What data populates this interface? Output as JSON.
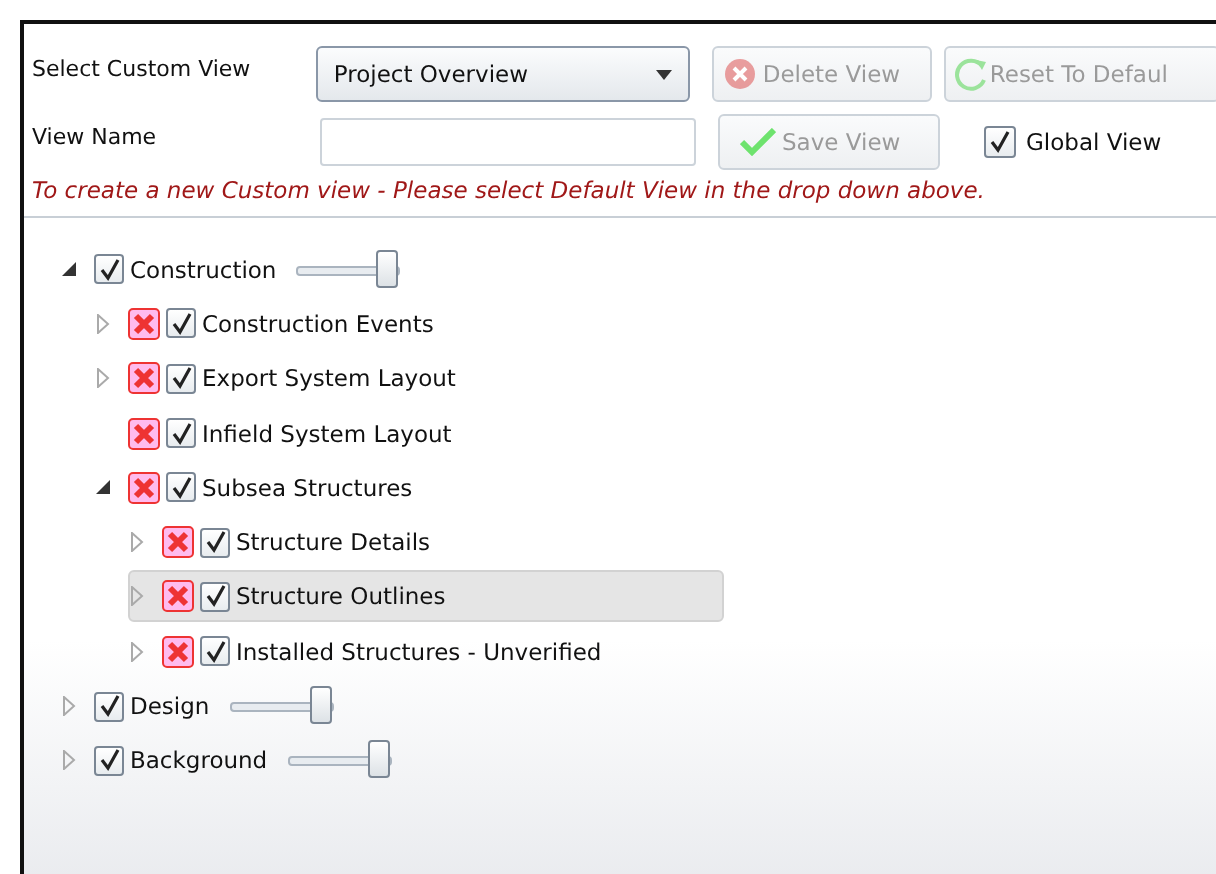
{
  "form": {
    "select_label": "Select Custom View",
    "select_value": "Project Overview",
    "name_label": "View Name",
    "buttons": [
      {
        "label": "Delete View",
        "kind": "delete",
        "disabled": true
      },
      {
        "label": "Reset To Defaul",
        "kind": "reset",
        "disabled": true
      },
      {
        "label": "Save View",
        "kind": "save",
        "disabled": true
      }
    ],
    "global_view": {
      "label": "Global View",
      "checked": true
    },
    "hint": "To create a new Custom view - Please select Default View in the drop down above."
  },
  "tree": [
    {
      "label": "Construction",
      "checked": true,
      "expanded": true,
      "leaf": false,
      "removable": false,
      "selected": false,
      "level": 1,
      "children": [
        {
          "label": "Construction Events",
          "checked": true,
          "expanded": false,
          "leaf": false,
          "removable": true,
          "selected": false
        },
        {
          "label": "Export System Layout",
          "checked": true,
          "expanded": false,
          "leaf": false,
          "removable": true,
          "selected": false
        },
        {
          "label": "Infield System Layout",
          "checked": true,
          "expanded": false,
          "leaf": true,
          "removable": true,
          "selected": false
        },
        {
          "label": "Subsea Structures",
          "checked": true,
          "expanded": true,
          "leaf": false,
          "removable": true,
          "selected": false,
          "children": [
            {
              "label": "Structure Details",
              "checked": true,
              "expanded": false,
              "leaf": false,
              "removable": true,
              "selected": false
            },
            {
              "label": "Structure Outlines",
              "checked": true,
              "expanded": false,
              "leaf": false,
              "removable": true,
              "selected": true
            },
            {
              "label": "Installed Structures - Unverified",
              "checked": true,
              "expanded": false,
              "leaf": false,
              "removable": true,
              "selected": false
            }
          ]
        }
      ]
    },
    {
      "label": "Design",
      "checked": true,
      "expanded": false,
      "leaf": false,
      "removable": false,
      "selected": false,
      "level": 1
    },
    {
      "label": "Background",
      "checked": true,
      "expanded": false,
      "leaf": false,
      "removable": false,
      "selected": false,
      "level": 1
    }
  ]
}
